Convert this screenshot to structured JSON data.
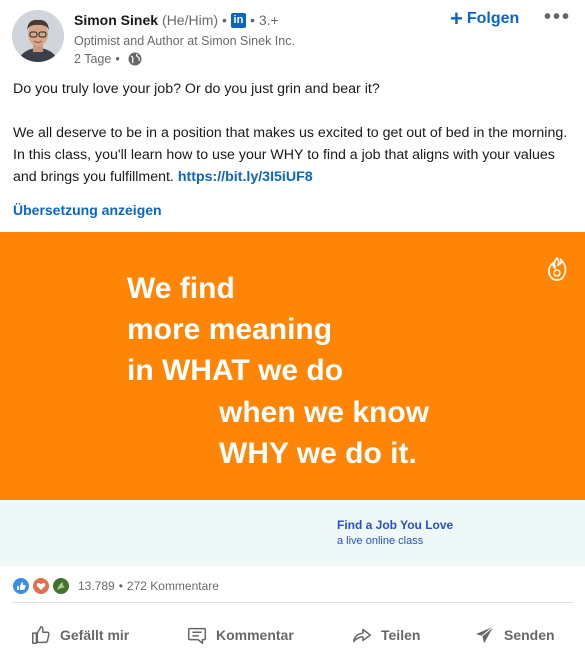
{
  "author": {
    "name": "Simon Sinek",
    "pronouns": "(He/Him)",
    "network_badge": "in",
    "degree": "3.+",
    "headline": "Optimist and Author at Simon Sinek Inc.",
    "time": "2 Tage",
    "bullet": "•"
  },
  "follow_label": "Folgen",
  "more_label": "•••",
  "post": {
    "line1": "Do you truly love your job? Or do you just grin and bear it?",
    "body": "We all deserve to be in a position that makes us excited to get out of bed in the morning. In this class, you'll learn how to use your WHY to find a job that aligns with your values and brings you fulfillment.",
    "link": "https://bit.ly/3I5iUF8"
  },
  "translate_label": "Übersetzung anzeigen",
  "banner": {
    "lines": [
      "We find",
      "more meaning",
      "in WHAT we do",
      "when we know",
      "WHY we do it."
    ],
    "bg_color": "#ff8506"
  },
  "subbanner": {
    "title": "Find a Job You Love",
    "subtitle": "a live online class"
  },
  "social": {
    "reaction_count": "13.789",
    "separator": "•",
    "comments": "272 Kommentare"
  },
  "actions": {
    "like": "Gefällt mir",
    "comment": "Kommentar",
    "share": "Teilen",
    "send": "Senden"
  },
  "icons": [
    "globe-icon",
    "plus-icon",
    "more-icon",
    "flame-icon",
    "like-icon",
    "heart-icon",
    "celebrate-icon",
    "thumb-icon",
    "comment-icon",
    "share-arrow-icon",
    "send-icon"
  ]
}
